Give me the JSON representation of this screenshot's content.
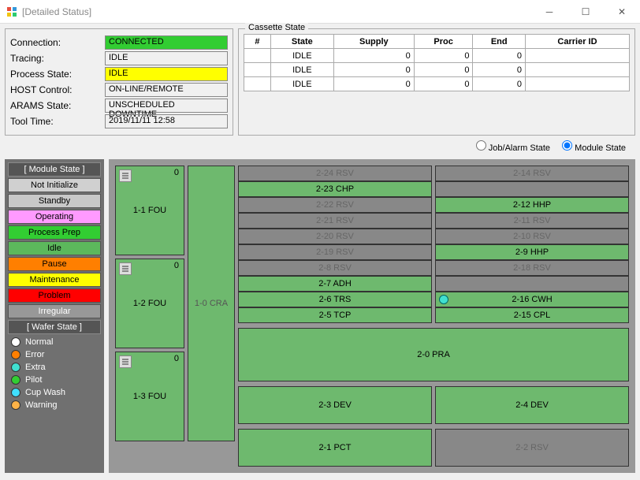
{
  "window": {
    "title": "[Detailed Status]"
  },
  "status": {
    "rows": [
      {
        "label": "Connection:",
        "value": "CONNECTED",
        "cls": "bg-green"
      },
      {
        "label": "Tracing:",
        "value": "IDLE",
        "cls": ""
      },
      {
        "label": "Process State:",
        "value": "IDLE",
        "cls": "bg-yellow"
      },
      {
        "label": "HOST Control:",
        "value": "ON-LINE/REMOTE",
        "cls": ""
      },
      {
        "label": "ARAMS State:",
        "value": "UNSCHEDULED DOWNTIME",
        "cls": ""
      },
      {
        "label": "Tool Time:",
        "value": "2019/11/11  12:58",
        "cls": ""
      }
    ]
  },
  "cassette": {
    "title": "Cassette State",
    "headers": [
      "#",
      "State",
      "Supply",
      "Proc",
      "End",
      "Carrier ID"
    ],
    "rows": [
      {
        "num": "",
        "state": "IDLE",
        "supply": "0",
        "proc": "0",
        "end": "0",
        "carrier": ""
      },
      {
        "num": "",
        "state": "IDLE",
        "supply": "0",
        "proc": "0",
        "end": "0",
        "carrier": ""
      },
      {
        "num": "",
        "state": "IDLE",
        "supply": "0",
        "proc": "0",
        "end": "0",
        "carrier": ""
      }
    ]
  },
  "view": {
    "jobalarm": "Job/Alarm State",
    "module": "Module State",
    "selected": "module"
  },
  "legend": {
    "module_header": "[ Module State ]",
    "module_items": [
      {
        "label": "Not Initialize",
        "cls": "lg-notinit"
      },
      {
        "label": "Standby",
        "cls": "lg-standby"
      },
      {
        "label": "Operating",
        "cls": "lg-operating"
      },
      {
        "label": "Process Prep",
        "cls": "lg-processprep"
      },
      {
        "label": "Idle",
        "cls": "lg-idle"
      },
      {
        "label": "Pause",
        "cls": "lg-pause"
      },
      {
        "label": "Maintenance",
        "cls": "lg-maintenance"
      },
      {
        "label": "Problem",
        "cls": "lg-problem"
      },
      {
        "label": "Irregular",
        "cls": "lg-irregular"
      }
    ],
    "wafer_header": "[ Wafer State ]",
    "wafer_items": [
      {
        "label": "Normal",
        "color": "#ffffff"
      },
      {
        "label": "Error",
        "color": "#ff7f00"
      },
      {
        "label": "Extra",
        "color": "#40e0d0"
      },
      {
        "label": "Pilot",
        "color": "#32cd32"
      },
      {
        "label": "Cup Wash",
        "color": "#40e0ff"
      },
      {
        "label": "Warning",
        "color": "#ffb347"
      }
    ]
  },
  "modules": {
    "fou": [
      {
        "label": "1-1 FOU",
        "count": "0"
      },
      {
        "label": "1-2 FOU",
        "count": "0"
      },
      {
        "label": "1-3 FOU",
        "count": "0"
      }
    ],
    "cra": "1-0 CRA",
    "rows": [
      [
        {
          "label": "2-24 RSV",
          "cls": "cell-gray"
        },
        {
          "label": "2-14 RSV",
          "cls": "cell-gray"
        }
      ],
      [
        {
          "label": "2-23 CHP",
          "cls": "cell-green"
        },
        {
          "label": "",
          "cls": "cell-gray"
        }
      ],
      [
        {
          "label": "2-22 RSV",
          "cls": "cell-gray"
        },
        {
          "label": "2-12 HHP",
          "cls": "cell-green"
        }
      ],
      [
        {
          "label": "2-21 RSV",
          "cls": "cell-gray"
        },
        {
          "label": "2-11 RSV",
          "cls": "cell-gray"
        }
      ],
      [
        {
          "label": "2-20 RSV",
          "cls": "cell-gray"
        },
        {
          "label": "2-10 RSV",
          "cls": "cell-gray"
        }
      ],
      [
        {
          "label": "2-19 RSV",
          "cls": "cell-gray"
        },
        {
          "label": "2-9 HHP",
          "cls": "cell-green"
        }
      ],
      [
        {
          "label": "2-8 RSV",
          "cls": "cell-gray"
        },
        {
          "label": "2-18 RSV",
          "cls": "cell-gray"
        }
      ],
      [
        {
          "label": "2-7 ADH",
          "cls": "cell-green"
        },
        {
          "label": "",
          "cls": "cell-gray"
        }
      ],
      [
        {
          "label": "2-6 TRS",
          "cls": "cell-green"
        },
        {
          "label": "2-16 CWH",
          "cls": "cell-green",
          "wafer": true
        }
      ],
      [
        {
          "label": "2-5 TCP",
          "cls": "cell-green"
        },
        {
          "label": "2-15 CPL",
          "cls": "cell-green"
        }
      ]
    ],
    "pra": "2-0 PRA",
    "dev": [
      {
        "label": "2-3 DEV",
        "cls": ""
      },
      {
        "label": "2-4 DEV",
        "cls": ""
      }
    ],
    "pct": [
      {
        "label": "2-1 PCT",
        "cls": ""
      },
      {
        "label": "2-2 RSV",
        "cls": "dev-gray"
      }
    ]
  }
}
